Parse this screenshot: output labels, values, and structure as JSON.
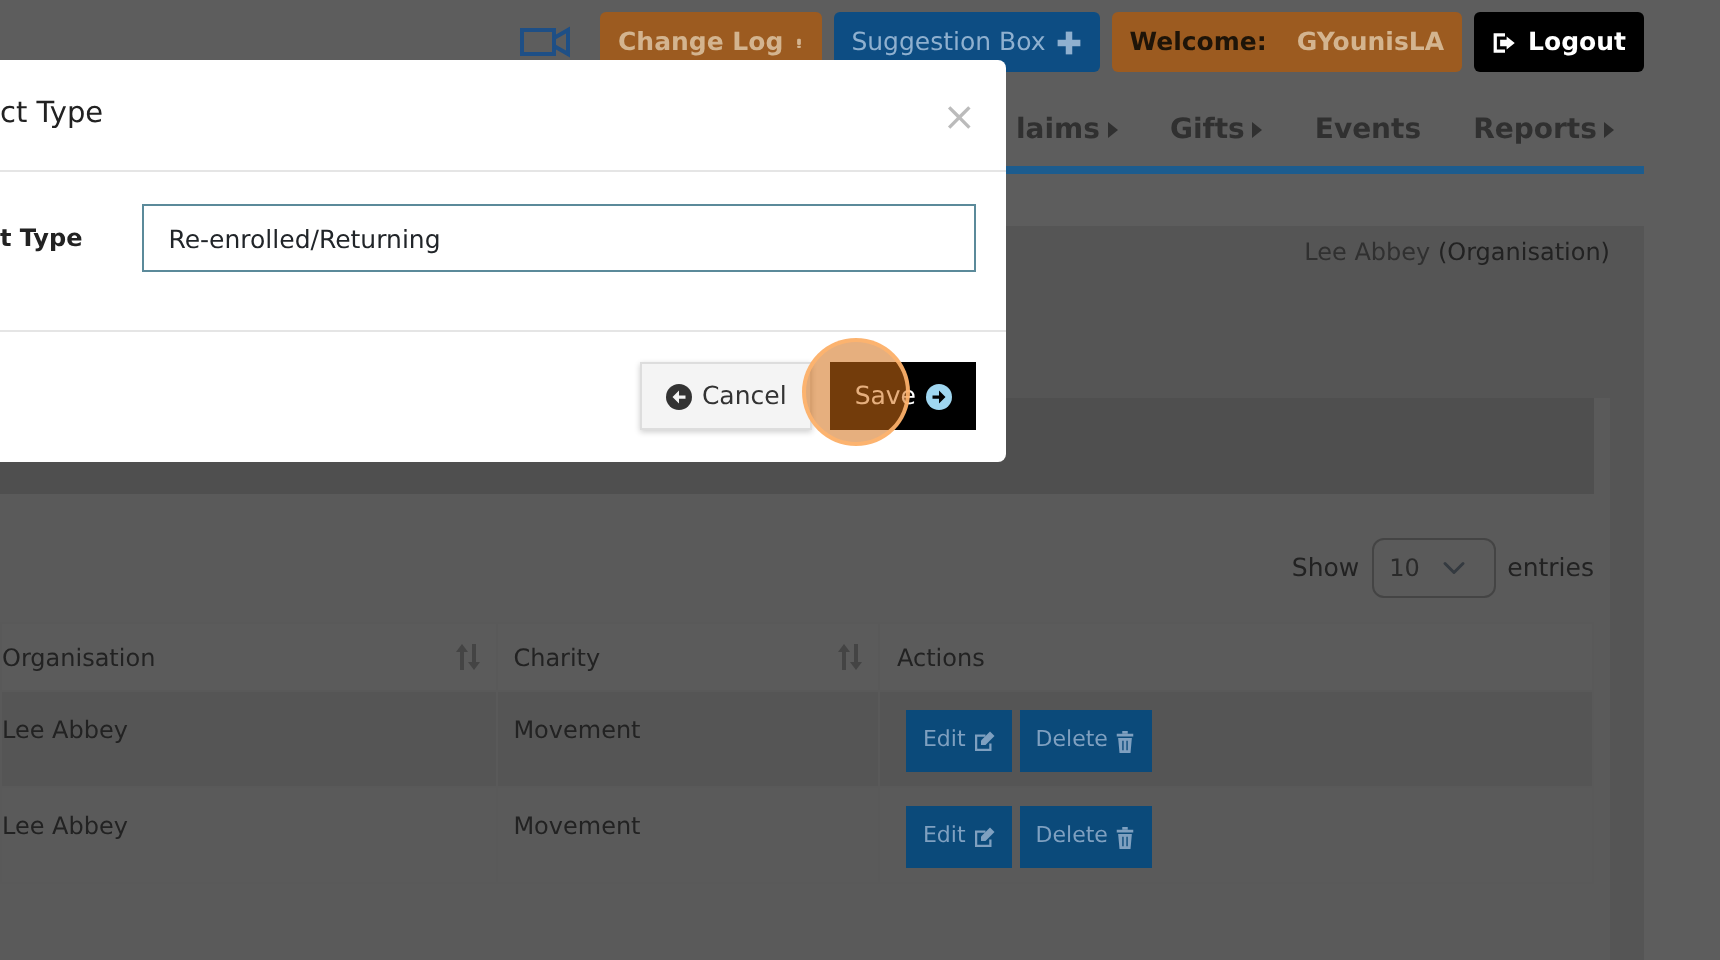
{
  "toolbar": {
    "buttons": [
      {
        "kind": "changelog",
        "label": "Change Log"
      },
      {
        "kind": "suggestion",
        "label": "Suggestion Box"
      },
      {
        "kind": "welcome",
        "label": "Welcome:",
        "user": "GYounisLA"
      },
      {
        "kind": "logout",
        "label": "Logout"
      }
    ]
  },
  "nav": [
    {
      "label": "laims",
      "has_menu": true
    },
    {
      "label": "Gifts",
      "has_menu": true
    },
    {
      "label": "Events",
      "has_menu": false
    },
    {
      "label": "Reports",
      "has_menu": true
    }
  ],
  "context": {
    "name": "Lee Abbey",
    "type": "(Organisation)"
  },
  "length": {
    "show": "Show",
    "value": "10",
    "suffix": "entries"
  },
  "table": {
    "columns": [
      {
        "label": "Organisation",
        "sortable": true
      },
      {
        "label": "Charity",
        "sortable": true
      },
      {
        "label": "Actions",
        "sortable": false
      }
    ],
    "rows": [
      {
        "organisation": "Lee Abbey",
        "charity": "Movement",
        "actions": [
          {
            "kind": "edit",
            "label": "Edit"
          },
          {
            "kind": "delete",
            "label": "Delete"
          }
        ]
      },
      {
        "organisation": "Lee Abbey",
        "charity": "Movement",
        "actions": [
          {
            "kind": "edit",
            "label": "Edit"
          },
          {
            "kind": "delete",
            "label": "Delete"
          }
        ]
      }
    ]
  },
  "modal": {
    "title": "ct Type",
    "close": "×",
    "field_label": "t Type",
    "value": "Re-enrolled/Returning",
    "buttons": [
      {
        "kind": "cancel",
        "label": "Cancel",
        "highlighted": false
      },
      {
        "kind": "save",
        "label": "Save",
        "highlighted": true
      }
    ]
  }
}
